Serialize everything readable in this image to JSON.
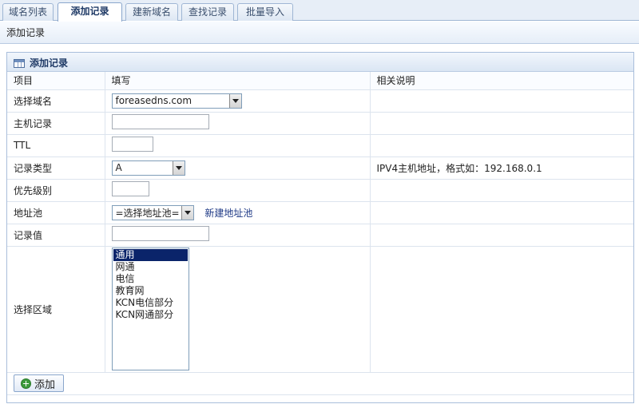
{
  "tabs": [
    {
      "label": "域名列表",
      "active": false
    },
    {
      "label": "添加记录",
      "active": true
    },
    {
      "label": "建新域名",
      "active": false
    },
    {
      "label": "查找记录",
      "active": false
    },
    {
      "label": "批量导入",
      "active": false
    }
  ],
  "breadcrumb": "添加记录",
  "panel": {
    "title": "添加记录",
    "columns": [
      "项目",
      "填写",
      "相关说明"
    ]
  },
  "form": {
    "domain_label": "选择域名",
    "domain_value": "foreasedns.com",
    "host_label": "主机记录",
    "host_value": "",
    "ttl_label": "TTL",
    "ttl_value": "",
    "type_label": "记录类型",
    "type_value": "A",
    "type_hint": "IPV4主机地址，格式如：192.168.0.1",
    "priority_label": "优先级别",
    "priority_value": "",
    "pool_label": "地址池",
    "pool_value": "=选择地址池=",
    "pool_link": "新建地址池",
    "record_label": "记录值",
    "record_value": "",
    "region_label": "选择区域",
    "regions": [
      "通用",
      "网通",
      "电信",
      "教育网",
      "KCN电信部分",
      "KCN网通部分"
    ],
    "region_selected": 0
  },
  "submit_label": "添加",
  "colors": {
    "accent": "#1f3a66",
    "selection": "#0a246a",
    "border": "#a9bedb"
  }
}
